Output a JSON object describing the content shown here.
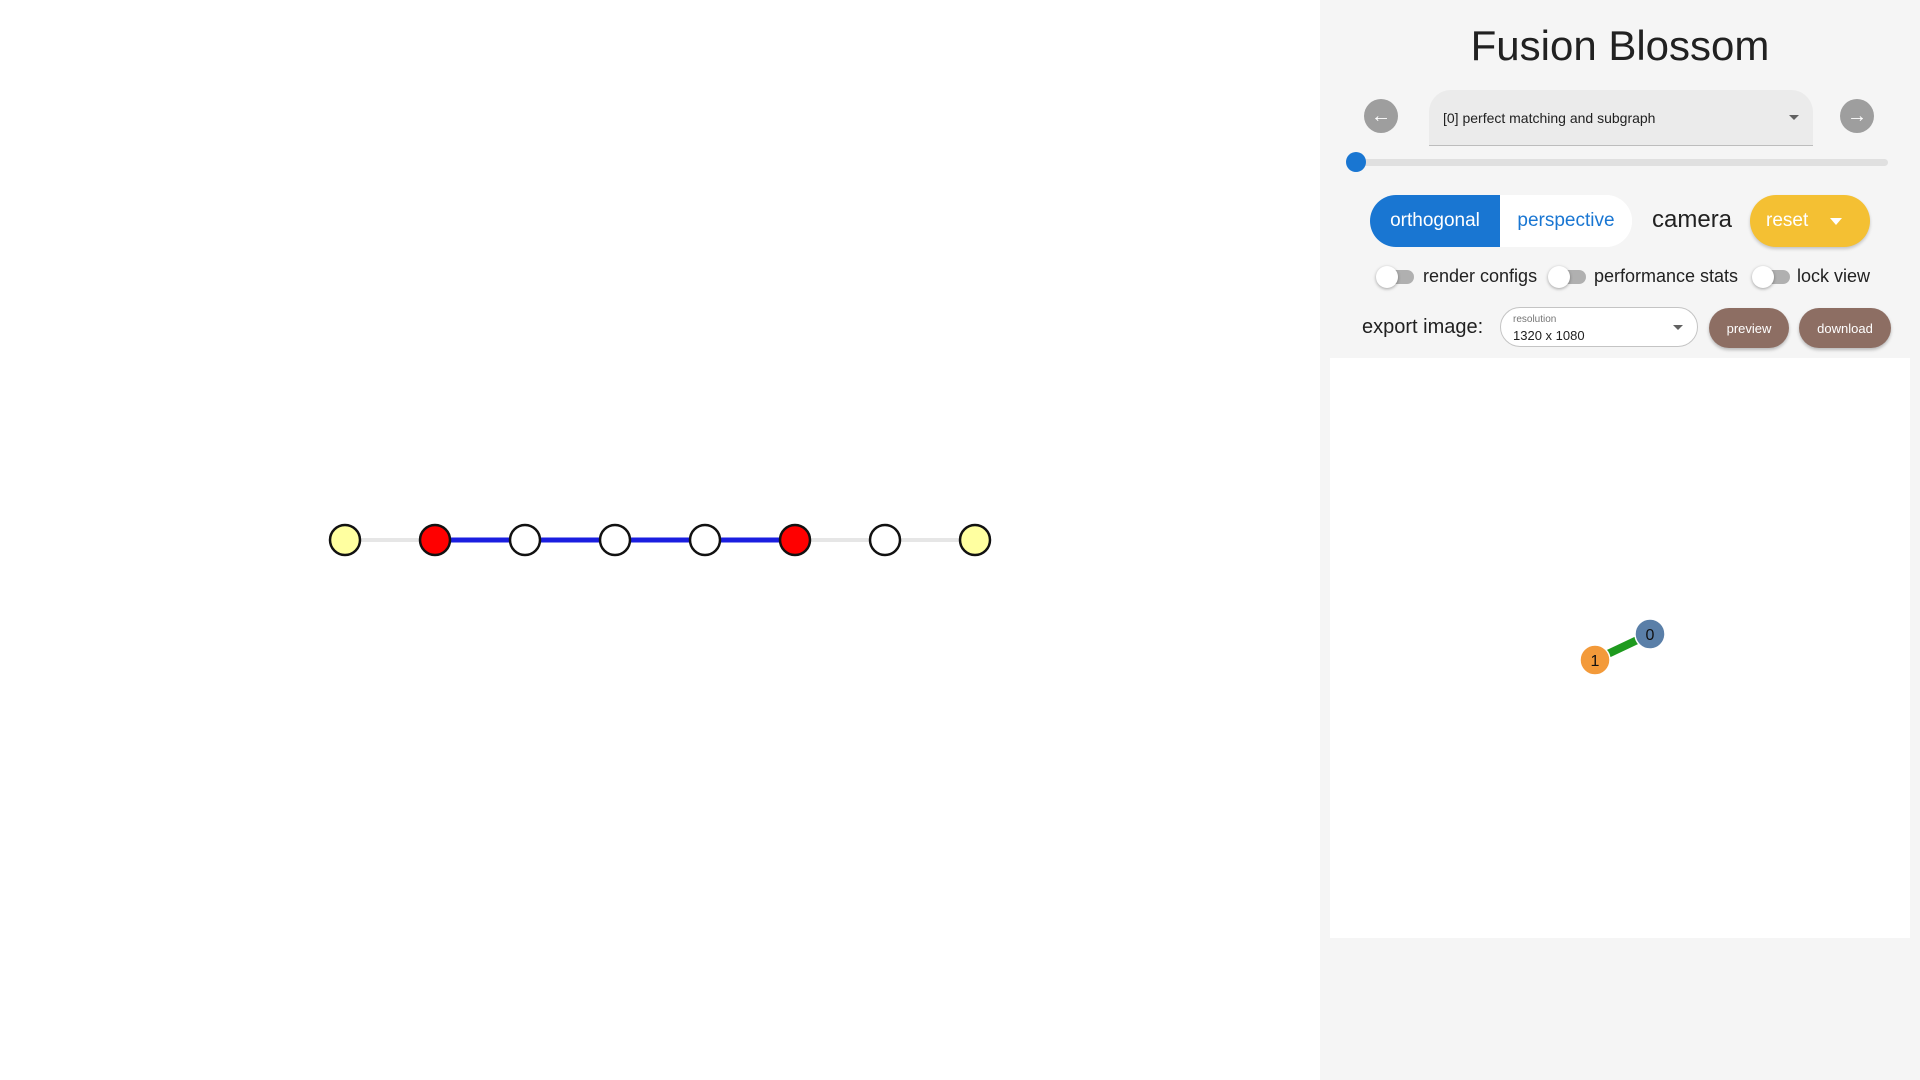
{
  "app": {
    "title": "Fusion Blossom"
  },
  "nav": {
    "prev_icon": "arrow-left-icon",
    "next_icon": "arrow-right-icon",
    "snapshot_label": "[0] perfect matching and subgraph",
    "snapshot_index": 0
  },
  "camera": {
    "orthogonal_label": "orthogonal",
    "perspective_label": "perspective",
    "label": "camera",
    "reset_label": "reset",
    "selected": "orthogonal"
  },
  "toggles": [
    {
      "label": "render configs",
      "on": false
    },
    {
      "label": "performance stats",
      "on": false
    },
    {
      "label": "lock view",
      "on": false
    }
  ],
  "export": {
    "label": "export image:",
    "resolution_caption": "resolution",
    "resolution_value": "1320 x 1080",
    "preview_label": "preview",
    "download_label": "download"
  },
  "graph": {
    "vertices": [
      {
        "type": "virtual",
        "color": "#ffffa0"
      },
      {
        "type": "defect",
        "color": "#ff0000"
      },
      {
        "type": "normal",
        "color": "#ffffff"
      },
      {
        "type": "normal",
        "color": "#ffffff"
      },
      {
        "type": "normal",
        "color": "#ffffff"
      },
      {
        "type": "defect",
        "color": "#ff0000"
      },
      {
        "type": "normal",
        "color": "#ffffff"
      },
      {
        "type": "virtual",
        "color": "#ffffa0"
      }
    ],
    "edges": [
      {
        "from": 0,
        "to": 1,
        "matched": false
      },
      {
        "from": 1,
        "to": 2,
        "matched": true
      },
      {
        "from": 2,
        "to": 3,
        "matched": true
      },
      {
        "from": 3,
        "to": 4,
        "matched": true
      },
      {
        "from": 4,
        "to": 5,
        "matched": true
      },
      {
        "from": 5,
        "to": 6,
        "matched": false
      },
      {
        "from": 6,
        "to": 7,
        "matched": false
      }
    ],
    "matched_color": "#1a1ee0",
    "unmatched_color": "#e6e6e6"
  },
  "mini_graph": {
    "nodes": [
      {
        "label": "0",
        "color": "#5a7fa8"
      },
      {
        "label": "1",
        "color": "#f39a3a"
      }
    ],
    "edge_color": "#1e9a1e"
  }
}
